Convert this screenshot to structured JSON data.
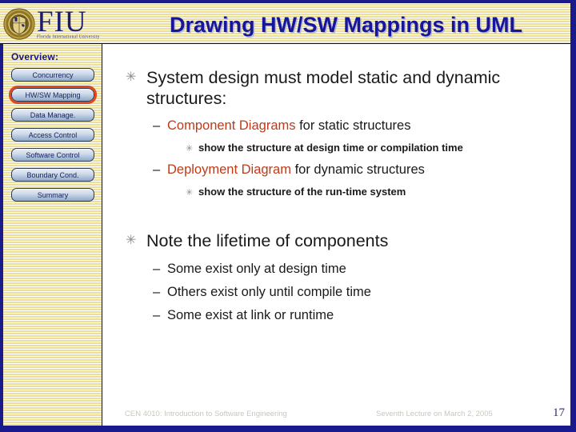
{
  "slide": {
    "title": "Drawing HW/SW Mappings in UML",
    "logo": {
      "wordmark": "FIU",
      "subtitle": "Florida International University",
      "seal_name": "fiu-seal"
    }
  },
  "sidebar": {
    "heading": "Overview:",
    "items": [
      {
        "label": "Concurrency",
        "active": false
      },
      {
        "label": "HW/SW Mapping",
        "active": true
      },
      {
        "label": "Data Manage.",
        "active": false
      },
      {
        "label": "Access Control",
        "active": false
      },
      {
        "label": "Software Control",
        "active": false
      },
      {
        "label": "Boundary Cond.",
        "active": false
      },
      {
        "label": "Summary",
        "active": false
      }
    ]
  },
  "content": {
    "bullet_marker": "✳",
    "dash_marker": "–",
    "b1": {
      "text": "System design must model static and dynamic structures:",
      "s1": {
        "highlight": "Component Diagrams",
        "rest": " for static structures"
      },
      "s1a": {
        "text": "show the structure at design time or compilation time"
      },
      "s2": {
        "highlight": "Deployment Diagram",
        "rest": " for dynamic structures"
      },
      "s2a": {
        "text": "show the structure of the run-time system"
      }
    },
    "b2": {
      "text": "Note the lifetime of components",
      "s1": {
        "text": "Some exist only at design time"
      },
      "s2": {
        "text": "Others exist only until  compile time"
      },
      "s3": {
        "text": "Some exist at link or runtime"
      }
    }
  },
  "footer": {
    "course": "CEN 4010: Introduction to Software Engineering",
    "lecture": "Seventh Lecture on March 2, 2005",
    "page": "17"
  },
  "colors": {
    "title_blue": "#16169b",
    "frame_navy": "#1a1a8c",
    "highlight_red": "#c03a18",
    "active_outline": "#e2491c",
    "stripe_cream": "#ecdf9c"
  }
}
